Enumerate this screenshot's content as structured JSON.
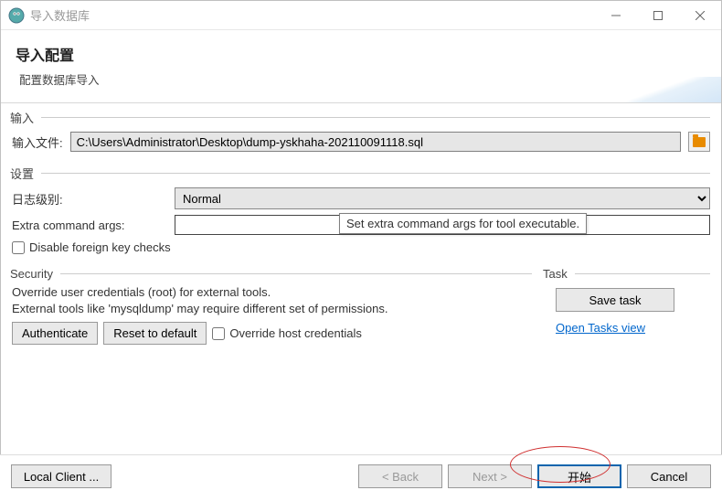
{
  "window": {
    "title": "导入数据库"
  },
  "banner": {
    "heading": "导入配置",
    "subtitle": "配置数据库导入"
  },
  "input_group": {
    "legend": "输入",
    "file_label": "输入文件:",
    "file_value": "C:\\Users\\Administrator\\Desktop\\dump-yskhaha-202110091118.sql"
  },
  "settings_group": {
    "legend": "设置",
    "loglevel_label": "日志级别:",
    "loglevel_value": "Normal",
    "extra_args_label": "Extra command args:",
    "extra_args_value": "",
    "extra_args_tooltip": "Set extra command args for tool executable.",
    "disable_fk_label": "Disable foreign key checks"
  },
  "security_group": {
    "legend": "Security",
    "line1": "Override user credentials (root) for external tools.",
    "line2": "External tools like 'mysqldump' may require different set of permissions.",
    "authenticate_btn": "Authenticate",
    "reset_btn": "Reset to default",
    "override_host_label": "Override host credentials"
  },
  "task_group": {
    "legend": "Task",
    "save_task_btn": "Save task",
    "open_tasks_link": "Open Tasks view"
  },
  "footer": {
    "local_client": "Local Client ...",
    "back": "< Back",
    "next": "Next >",
    "start": "开始",
    "cancel": "Cancel"
  }
}
